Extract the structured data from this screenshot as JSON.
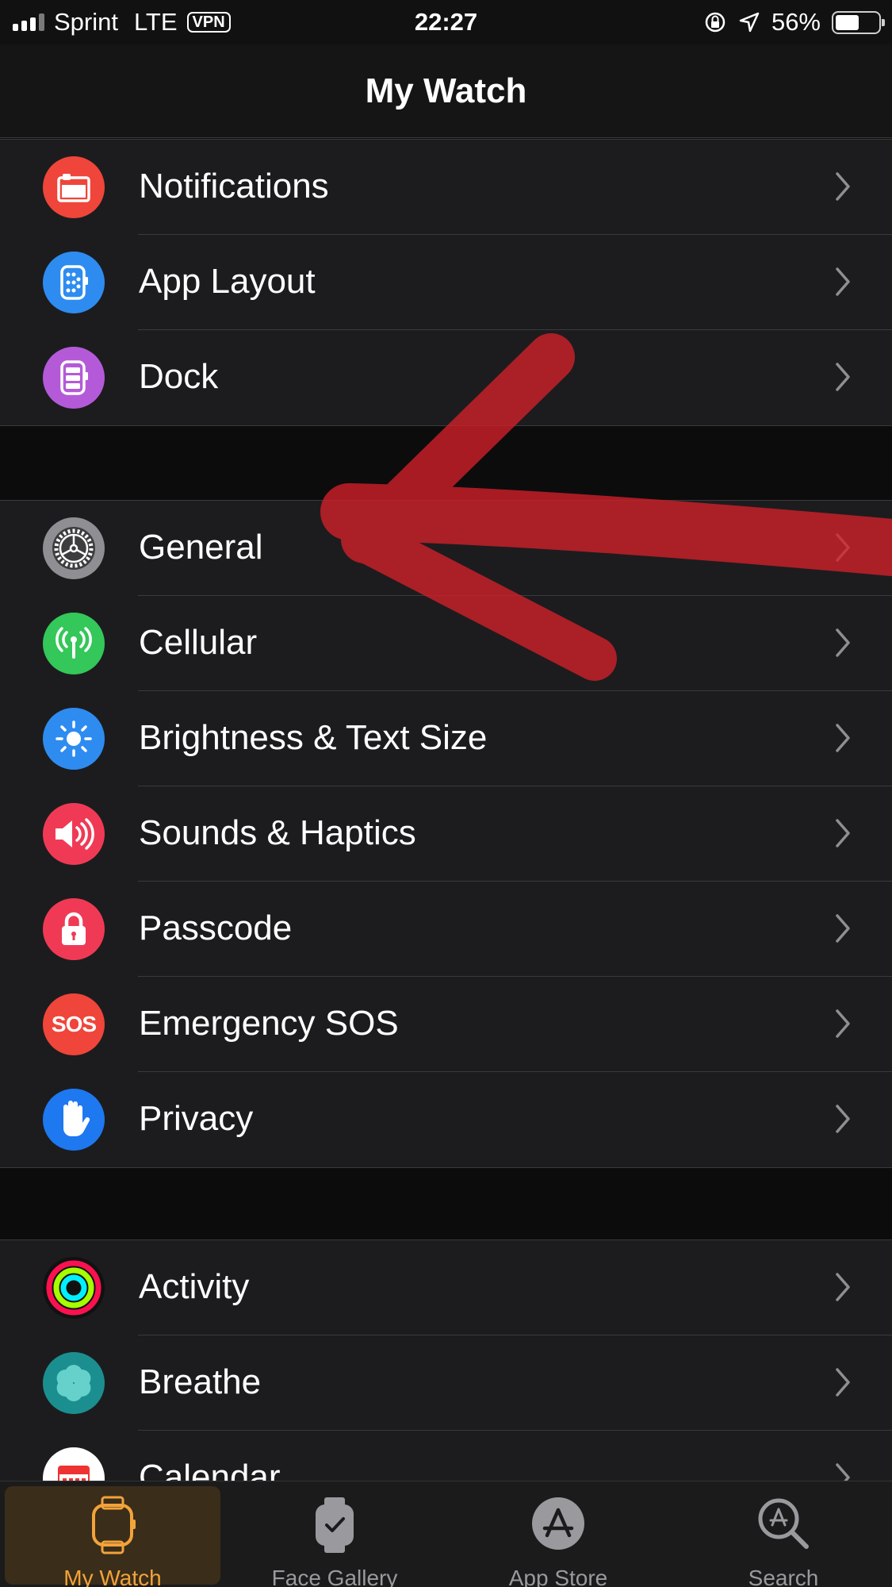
{
  "status_bar": {
    "carrier": "Sprint",
    "network": "LTE",
    "vpn": "VPN",
    "time": "22:27",
    "battery": "56%",
    "battery_level": 0.56
  },
  "nav": {
    "title": "My Watch"
  },
  "groups": [
    {
      "rows": [
        {
          "label": "Notifications",
          "icon": "notifications-icon",
          "color": "#f0453a"
        },
        {
          "label": "App Layout",
          "icon": "app-layout-icon",
          "color": "#2e8cf0"
        },
        {
          "label": "Dock",
          "icon": "dock-icon",
          "color": "#b45ad8"
        }
      ]
    },
    {
      "rows": [
        {
          "label": "General",
          "icon": "gear-icon",
          "color": "#8e8e93"
        },
        {
          "label": "Cellular",
          "icon": "antenna-icon",
          "color": "#34c759"
        },
        {
          "label": "Brightness & Text Size",
          "icon": "sun-icon",
          "color": "#2e8cf0"
        },
        {
          "label": "Sounds & Haptics",
          "icon": "speaker-icon",
          "color": "#f03a55"
        },
        {
          "label": "Passcode",
          "icon": "lock-icon",
          "color": "#f03a55"
        },
        {
          "label": "Emergency SOS",
          "icon": "sos-icon",
          "color": "#f0453a"
        },
        {
          "label": "Privacy",
          "icon": "hand-icon",
          "color": "#1e78f0"
        }
      ]
    },
    {
      "rows": [
        {
          "label": "Activity",
          "icon": "activity-rings-icon",
          "color": "#111111"
        },
        {
          "label": "Breathe",
          "icon": "breathe-icon",
          "color": "#1b8f8f"
        },
        {
          "label": "Calendar",
          "icon": "calendar-icon",
          "color": "#ffffff"
        }
      ]
    }
  ],
  "icon_text": {
    "sos": "SOS"
  },
  "tabs": [
    {
      "label": "My Watch",
      "icon": "watch-icon",
      "active": true
    },
    {
      "label": "Face Gallery",
      "icon": "face-gallery-icon",
      "active": false
    },
    {
      "label": "App Store",
      "icon": "app-store-icon",
      "active": false
    },
    {
      "label": "Search",
      "icon": "search-icon",
      "active": false
    }
  ],
  "colors": {
    "accent": "#f2a33a",
    "annotation": "#d4202a"
  }
}
